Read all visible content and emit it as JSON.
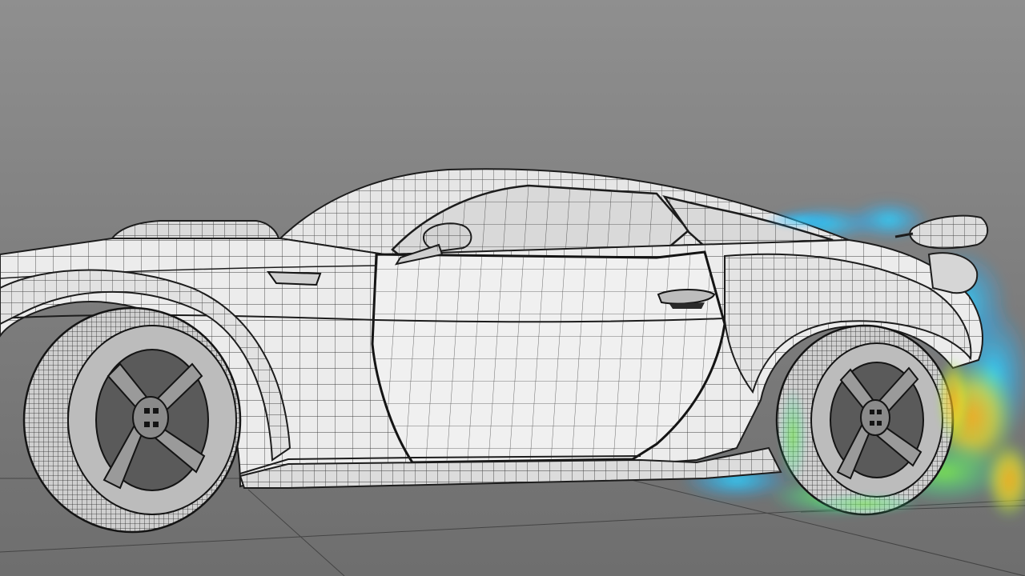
{
  "viewport": {
    "label": "",
    "display_mode": "wireframe",
    "background_colors": [
      "#8f8f8f",
      "#7c7c7c",
      "#6e6e6e"
    ],
    "wire_color": "#2a2a2a",
    "body_color": "#e6e6e6"
  },
  "model": {
    "subject": "sports-car",
    "view": "side-left"
  },
  "simulation": {
    "type": "tire-smoke",
    "palette": [
      "#2fd6ff",
      "#1aa0ff",
      "#26e0b0",
      "#7ee64a",
      "#e6e02a",
      "#ffae1a"
    ]
  }
}
